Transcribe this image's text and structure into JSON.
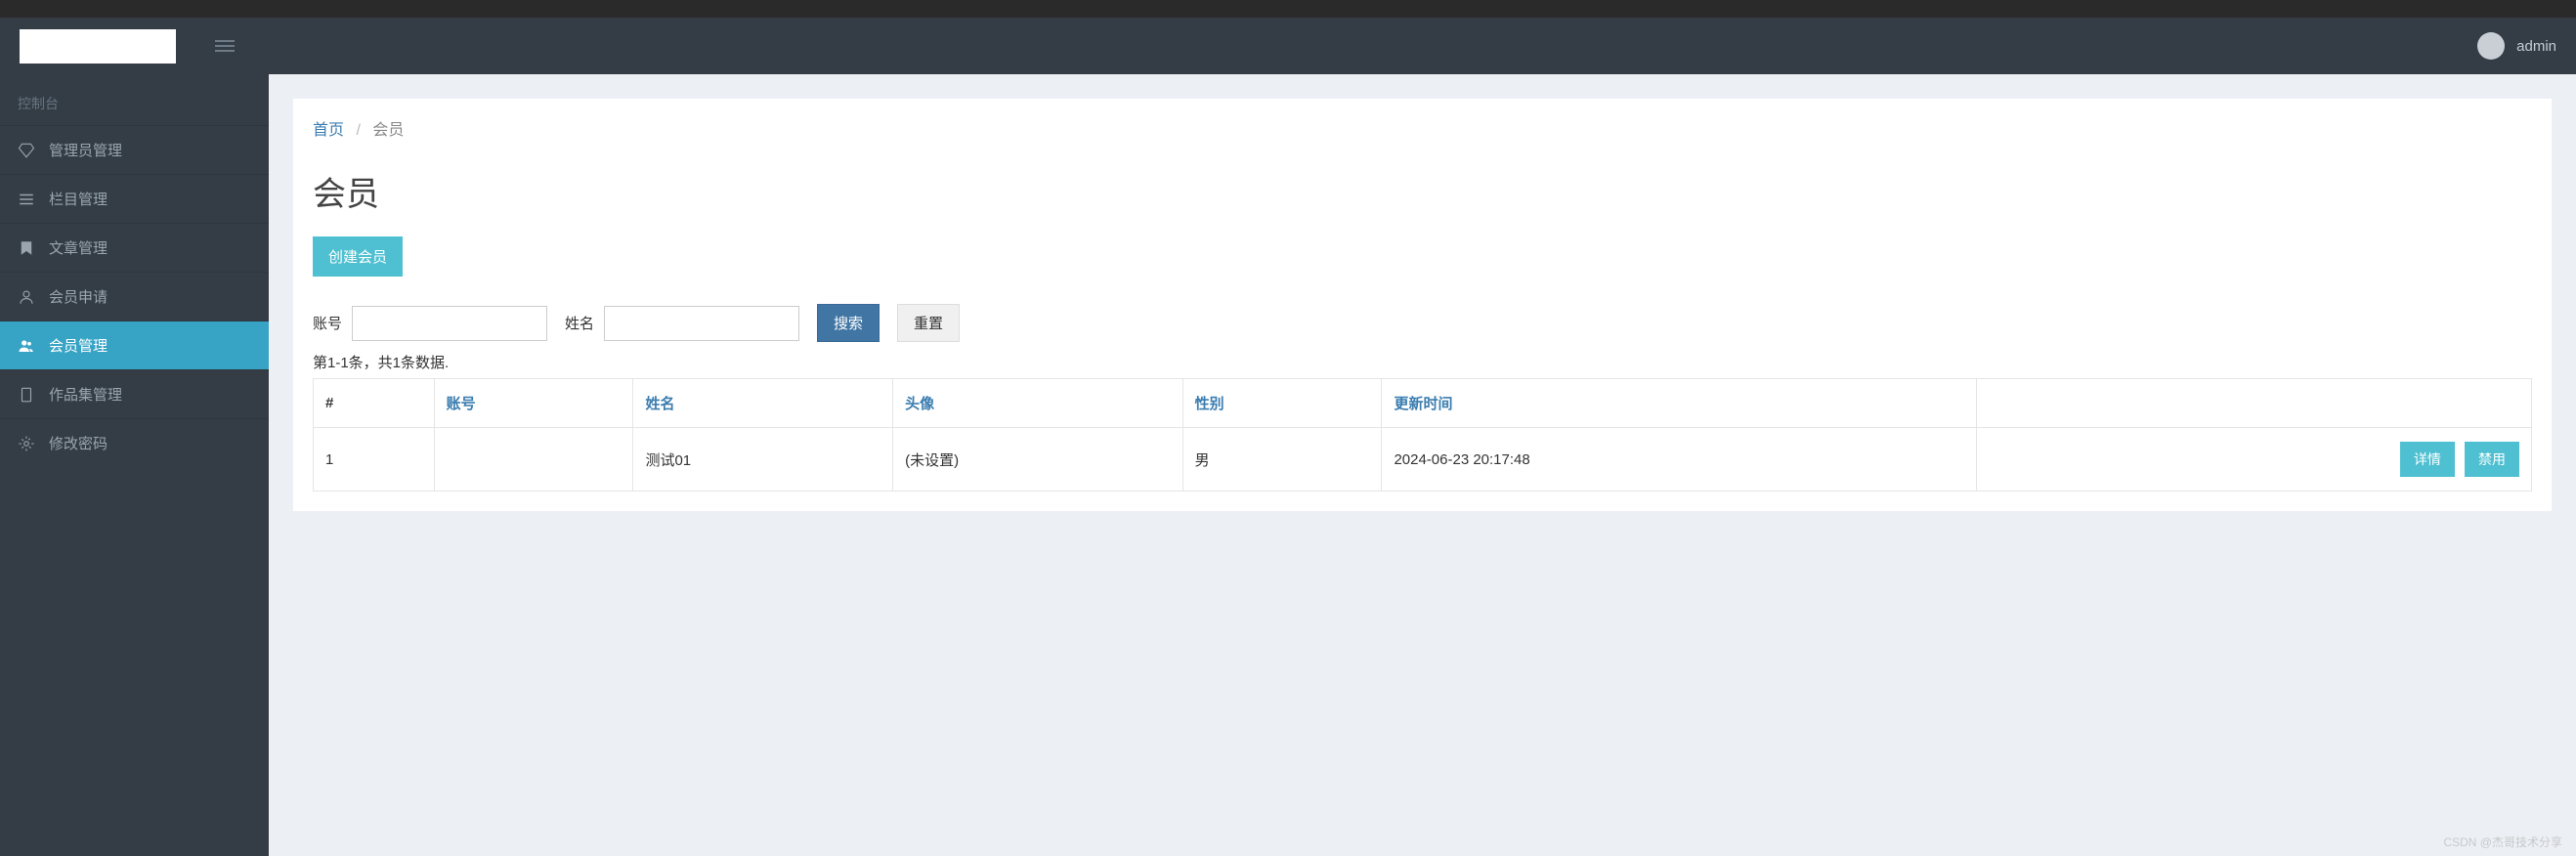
{
  "header": {
    "username": "admin"
  },
  "sidebar": {
    "heading": "控制台",
    "items": [
      {
        "label": "管理员管理"
      },
      {
        "label": "栏目管理"
      },
      {
        "label": "文章管理"
      },
      {
        "label": "会员申请"
      },
      {
        "label": "会员管理"
      },
      {
        "label": "作品集管理"
      },
      {
        "label": "修改密码"
      }
    ]
  },
  "breadcrumb": {
    "home": "首页",
    "current": "会员"
  },
  "page": {
    "title": "会员",
    "create_label": "创建会员"
  },
  "search": {
    "account_label": "账号",
    "name_label": "姓名",
    "account_value": "",
    "name_value": "",
    "search_btn": "搜索",
    "reset_btn": "重置"
  },
  "table": {
    "summary": "第1-1条，共1条数据.",
    "headers": {
      "idx": "#",
      "account": "账号",
      "name": "姓名",
      "avatar": "头像",
      "gender": "性别",
      "updated": "更新时间"
    },
    "rows": [
      {
        "idx": "1",
        "account": "",
        "name": "测试01",
        "avatar": "(未设置)",
        "gender": "男",
        "updated": "2024-06-23 20:17:48"
      }
    ],
    "actions": {
      "detail": "详情",
      "disable": "禁用"
    }
  },
  "watermark": "CSDN @杰哥技术分享"
}
